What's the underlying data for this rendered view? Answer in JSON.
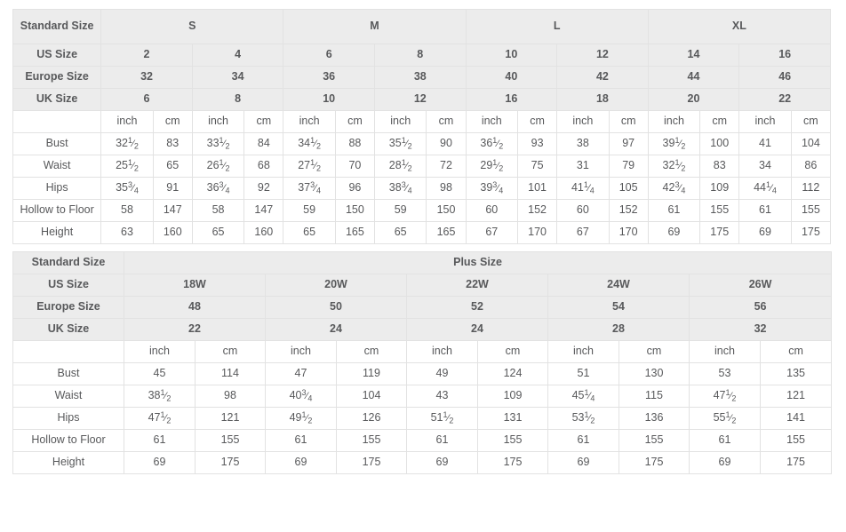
{
  "standard_table": {
    "corner_label": "Standard Size",
    "size_groups": [
      "S",
      "M",
      "L",
      "XL"
    ],
    "rows_header": [
      {
        "label": "US Size",
        "values": [
          "2",
          "4",
          "6",
          "8",
          "10",
          "12",
          "14",
          "16"
        ]
      },
      {
        "label": "Europe Size",
        "values": [
          "32",
          "34",
          "36",
          "38",
          "40",
          "42",
          "44",
          "46"
        ]
      },
      {
        "label": "UK Size",
        "values": [
          "6",
          "8",
          "10",
          "12",
          "16",
          "18",
          "20",
          "22"
        ]
      }
    ],
    "unit_label_inch": "inch",
    "unit_label_cm": "cm",
    "measure_rows": [
      {
        "label": "Bust",
        "values": [
          "32 1/2",
          "83",
          "33 1/2",
          "84",
          "34 1/2",
          "88",
          "35 1/2",
          "90",
          "36 1/2",
          "93",
          "38",
          "97",
          "39 1/2",
          "100",
          "41",
          "104"
        ]
      },
      {
        "label": "Waist",
        "values": [
          "25 1/2",
          "65",
          "26 1/2",
          "68",
          "27 1/2",
          "70",
          "28 1/2",
          "72",
          "29 1/2",
          "75",
          "31",
          "79",
          "32 1/2",
          "83",
          "34",
          "86"
        ]
      },
      {
        "label": "Hips",
        "values": [
          "35 3/4",
          "91",
          "36 3/4",
          "92",
          "37 3/4",
          "96",
          "38 3/4",
          "98",
          "39 3/4",
          "101",
          "41 1/4",
          "105",
          "42 3/4",
          "109",
          "44 1/4",
          "112"
        ]
      },
      {
        "label": "Hollow to Floor",
        "values": [
          "58",
          "147",
          "58",
          "147",
          "59",
          "150",
          "59",
          "150",
          "60",
          "152",
          "60",
          "152",
          "61",
          "155",
          "61",
          "155"
        ]
      },
      {
        "label": "Height",
        "values": [
          "63",
          "160",
          "65",
          "160",
          "65",
          "165",
          "65",
          "165",
          "67",
          "170",
          "67",
          "170",
          "69",
          "175",
          "69",
          "175"
        ]
      }
    ]
  },
  "plus_table": {
    "corner_label": "Standard Size",
    "section_title": "Plus Size",
    "rows_header": [
      {
        "label": "US Size",
        "values": [
          "18W",
          "20W",
          "22W",
          "24W",
          "26W"
        ]
      },
      {
        "label": "Europe Size",
        "values": [
          "48",
          "50",
          "52",
          "54",
          "56"
        ]
      },
      {
        "label": "UK Size",
        "values": [
          "22",
          "24",
          "24",
          "28",
          "32"
        ]
      }
    ],
    "unit_label_inch": "inch",
    "unit_label_cm": "cm",
    "measure_rows": [
      {
        "label": "Bust",
        "values": [
          "45",
          "114",
          "47",
          "119",
          "49",
          "124",
          "51",
          "130",
          "53",
          "135"
        ]
      },
      {
        "label": "Waist",
        "values": [
          "38 1/2",
          "98",
          "40 3/4",
          "104",
          "43",
          "109",
          "45 1/4",
          "115",
          "47 1/2",
          "121"
        ]
      },
      {
        "label": "Hips",
        "values": [
          "47 1/2",
          "121",
          "49 1/2",
          "126",
          "51 1/2",
          "131",
          "53 1/2",
          "136",
          "55 1/2",
          "141"
        ]
      },
      {
        "label": "Hollow to Floor",
        "values": [
          "61",
          "155",
          "61",
          "155",
          "61",
          "155",
          "61",
          "155",
          "61",
          "155"
        ]
      },
      {
        "label": "Height",
        "values": [
          "69",
          "175",
          "69",
          "175",
          "69",
          "175",
          "69",
          "175",
          "69",
          "175"
        ]
      }
    ]
  },
  "colors": {
    "header_bg": "#ececec",
    "border": "#e2e2e2",
    "header_text": "#2b2b2b",
    "body_text": "#58595b",
    "unit_text": "#8a8c8e"
  }
}
